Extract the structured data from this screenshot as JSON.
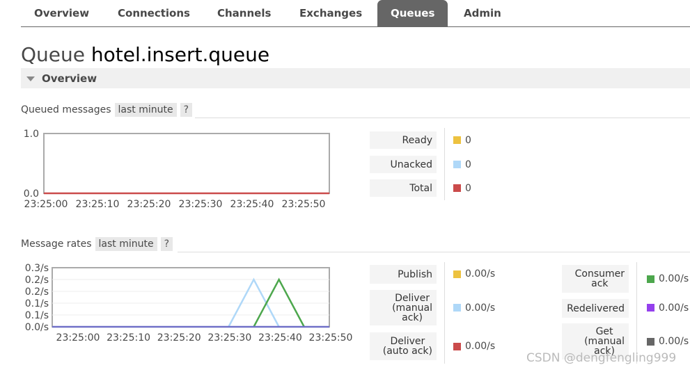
{
  "nav": {
    "tabs": [
      {
        "label": "Overview",
        "active": false
      },
      {
        "label": "Connections",
        "active": false
      },
      {
        "label": "Channels",
        "active": false
      },
      {
        "label": "Exchanges",
        "active": false
      },
      {
        "label": "Queues",
        "active": true
      },
      {
        "label": "Admin",
        "active": false
      }
    ]
  },
  "page": {
    "title_prefix": "Queue",
    "queue_name": "hotel.insert.queue"
  },
  "overview_section": {
    "label": "Overview"
  },
  "queued_messages": {
    "heading": "Queued messages",
    "range_label": "last minute",
    "help_label": "?",
    "stats": [
      {
        "label": "Ready",
        "value": "0",
        "color": "#edc240"
      },
      {
        "label": "Unacked",
        "value": "0",
        "color": "#afd8f8"
      },
      {
        "label": "Total",
        "value": "0",
        "color": "#cb4b4b"
      }
    ]
  },
  "message_rates": {
    "heading": "Message rates",
    "range_label": "last minute",
    "help_label": "?",
    "stats_left": [
      {
        "label": "Publish",
        "value": "0.00/s",
        "color": "#edc240"
      },
      {
        "label": "Deliver\n(manual\nack)",
        "value": "0.00/s",
        "color": "#afd8f8"
      },
      {
        "label": "Deliver\n(auto ack)",
        "value": "0.00/s",
        "color": "#cb4b4b"
      }
    ],
    "stats_right": [
      {
        "label": "Consumer\nack",
        "value": "0.00/s",
        "color": "#4da74d"
      },
      {
        "label": "Redelivered",
        "value": "0.00/s",
        "color": "#9440ed"
      },
      {
        "label": "Get\n(manual\nack)",
        "value": "0.00/s",
        "color": "#666666"
      }
    ]
  },
  "chart_data": [
    {
      "type": "line",
      "title": "Queued messages",
      "x": [
        "23:25:00",
        "23:25:10",
        "23:25:20",
        "23:25:30",
        "23:25:40",
        "23:25:50"
      ],
      "y_ticks": [
        "1.0",
        "0.0"
      ],
      "ylim": [
        0,
        1
      ],
      "series": [
        {
          "name": "Total",
          "color": "#cb4b4b",
          "values": [
            0,
            0,
            0,
            0,
            0,
            0
          ]
        }
      ]
    },
    {
      "type": "line",
      "title": "Message rates",
      "x": [
        "23:25:00",
        "23:25:10",
        "23:25:20",
        "23:25:30",
        "23:25:40",
        "23:25:50"
      ],
      "y_ticks": [
        "0.3/s",
        "0.2/s",
        "0.2/s",
        "0.1/s",
        "0.1/s",
        "0.0/s"
      ],
      "ylim": [
        0,
        0.25
      ],
      "series": [
        {
          "name": "Deliver (manual ack)",
          "color": "#afd8f8",
          "points": [
            [
              35,
              0
            ],
            [
              40,
              0.2
            ],
            [
              45,
              0
            ]
          ]
        },
        {
          "name": "Consumer ack",
          "color": "#4da74d",
          "points": [
            [
              40,
              0
            ],
            [
              45,
              0.2
            ],
            [
              50,
              0
            ]
          ]
        },
        {
          "name": "Get (manual ack)",
          "color": "#7070c8",
          "points": [
            [
              0,
              0
            ],
            [
              55,
              0
            ]
          ]
        }
      ]
    }
  ],
  "watermark": "CSDN @dengfengling999"
}
